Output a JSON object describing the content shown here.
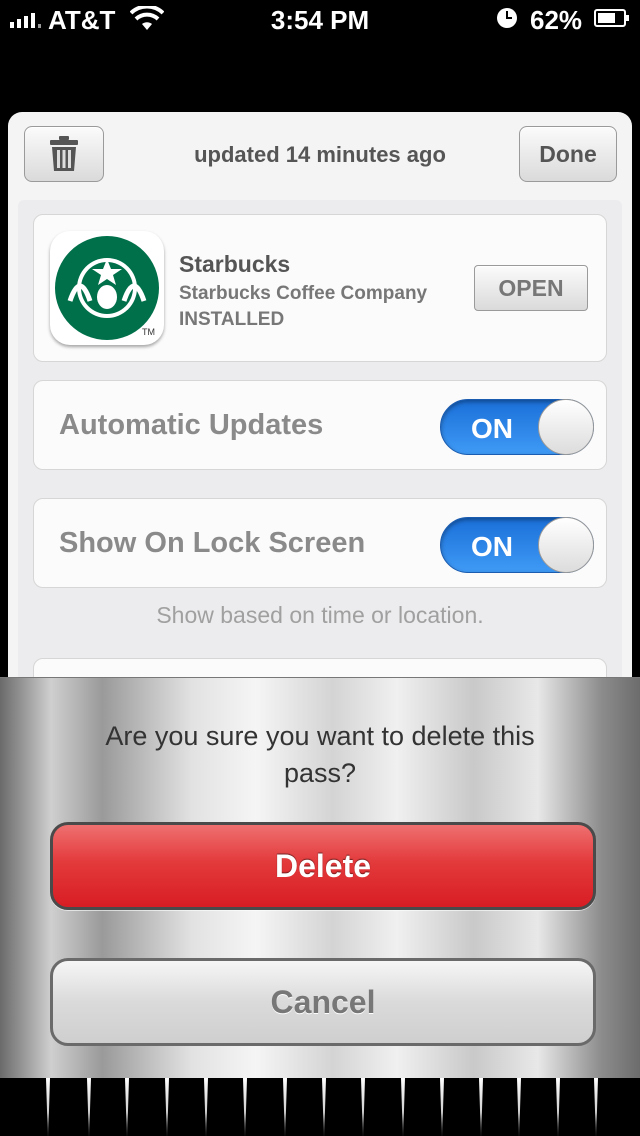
{
  "status_bar": {
    "carrier": "AT&T",
    "time": "3:54 PM",
    "battery": "62%"
  },
  "pass": {
    "updated_text": "updated 14 minutes ago",
    "done_label": "Done",
    "app": {
      "name": "Starbucks",
      "company": "Starbucks Coffee Company",
      "status": "INSTALLED",
      "open_label": "OPEN"
    },
    "settings": [
      {
        "label": "Automatic Updates",
        "state": "ON"
      },
      {
        "label": "Show On Lock Screen",
        "state": "ON"
      }
    ],
    "caption": "Show based on time or location."
  },
  "action_sheet": {
    "message": "Are you sure you want to delete this pass?",
    "delete_label": "Delete",
    "cancel_label": "Cancel"
  },
  "icons": [
    "signal-bars-icon",
    "wifi-icon",
    "alarm-clock-icon",
    "battery-icon",
    "trash-icon",
    "starbucks-logo-icon"
  ],
  "colors": {
    "switch_on": "#2f86ea",
    "delete_button": "#e0262b",
    "starbucks_green": "#00704a"
  }
}
